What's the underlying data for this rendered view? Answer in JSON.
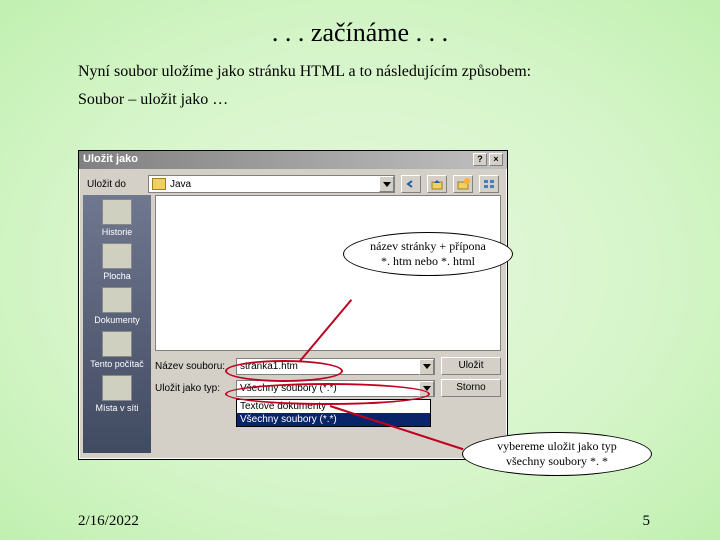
{
  "title": ". . . začínáme . . .",
  "intro": "Nyní soubor uložíme jako stránku HTML a to následujícím způsobem:",
  "step": "Soubor – uložit jako …",
  "dialog": {
    "title": "Uložit jako",
    "savein_label": "Uložit do",
    "folder": "Java",
    "places": [
      "Historie",
      "Plocha",
      "Dokumenty",
      "Tento počítač",
      "Místa v síti"
    ],
    "filename_label": "Název souboru:",
    "filename": "stránka1.htm",
    "filetype_label": "Uložit jako typ:",
    "filetype": "Všechny soubory (*.*)",
    "type_options": [
      "Textové dokumenty",
      "Všechny soubory (*.*)"
    ],
    "save_btn": "Uložit",
    "cancel_btn": "Storno"
  },
  "note1": {
    "line1": "název stránky + přípona",
    "line2": "*. htm nebo *. html"
  },
  "note2": {
    "line1": "vybereme uložit jako typ",
    "line2": "všechny soubory *. *"
  },
  "footer": {
    "date": "2/16/2022",
    "page": "5"
  }
}
